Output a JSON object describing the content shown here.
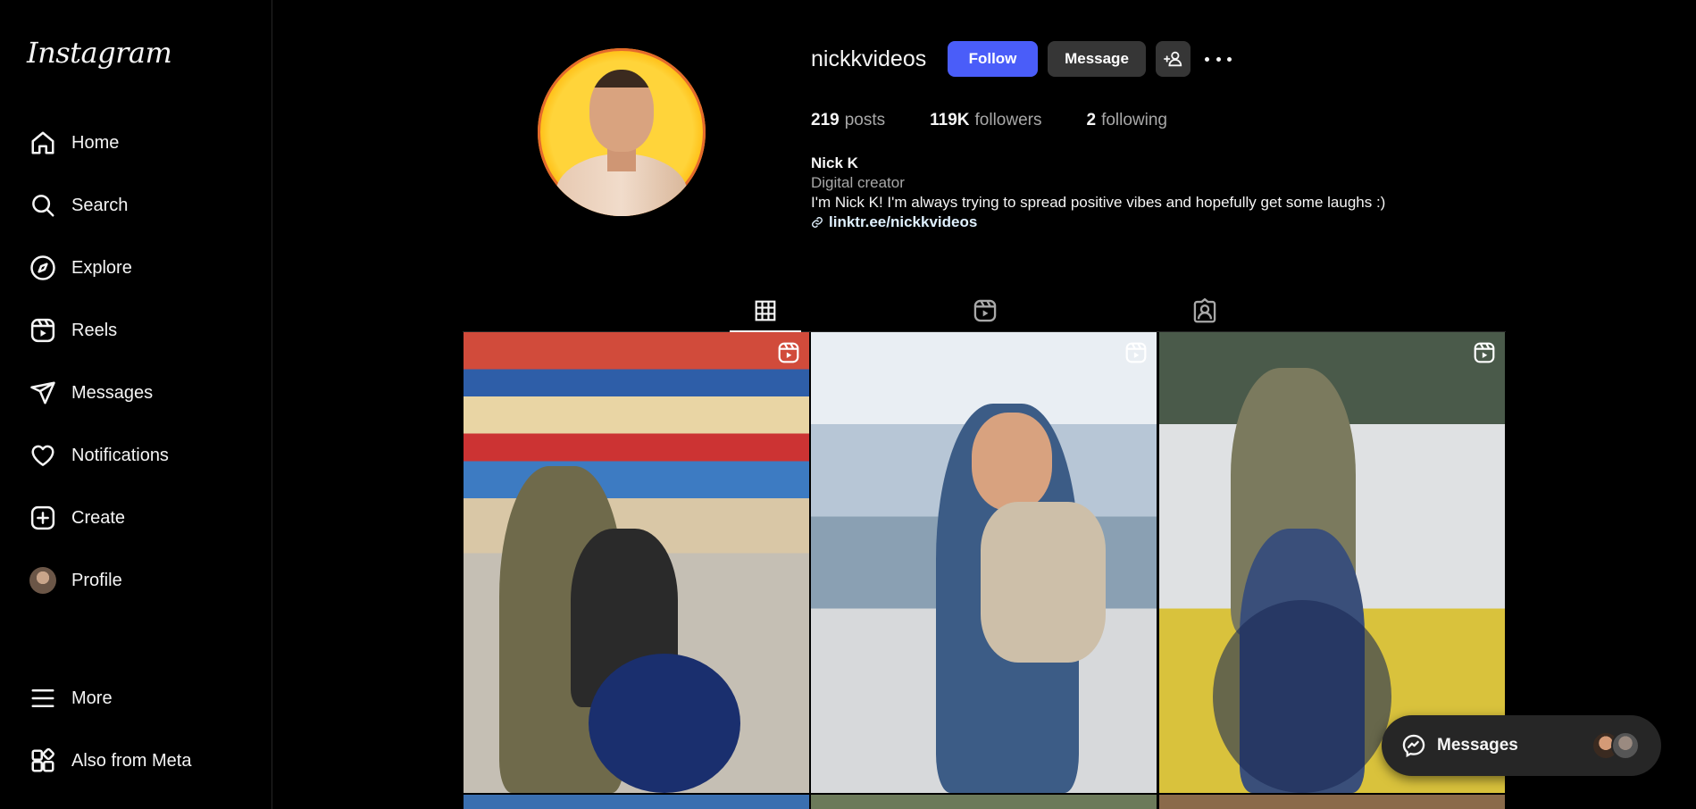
{
  "app": {
    "logo": "Instagram"
  },
  "sidebar": {
    "items": [
      {
        "label": "Home",
        "icon": "home-icon"
      },
      {
        "label": "Search",
        "icon": "search-icon"
      },
      {
        "label": "Explore",
        "icon": "compass-icon"
      },
      {
        "label": "Reels",
        "icon": "reels-icon"
      },
      {
        "label": "Messages",
        "icon": "send-icon"
      },
      {
        "label": "Notifications",
        "icon": "heart-icon"
      },
      {
        "label": "Create",
        "icon": "plus-square-icon"
      },
      {
        "label": "Profile",
        "icon": "avatar"
      }
    ],
    "more": "More",
    "also_from_meta": "Also from Meta"
  },
  "profile": {
    "username": "nickkvideos",
    "follow_label": "Follow",
    "message_label": "Message",
    "posts_count": "219",
    "posts_label": "posts",
    "followers_count": "119K",
    "followers_label": "followers",
    "following_count": "2",
    "following_label": "following",
    "name": "Nick K",
    "category": "Digital creator",
    "bio": "I'm Nick K! I'm always trying to spread positive vibes and hopefully get some laughs :)",
    "link": "linktr.ee/nickkvideos"
  },
  "tabs": [
    {
      "icon": "grid-icon",
      "active": true
    },
    {
      "icon": "reels-icon",
      "active": false
    },
    {
      "icon": "tagged-icon",
      "active": false
    }
  ],
  "messages_pill": {
    "label": "Messages"
  },
  "colors": {
    "accent": "#4a5df9",
    "background": "#000000",
    "surface": "#363636"
  }
}
